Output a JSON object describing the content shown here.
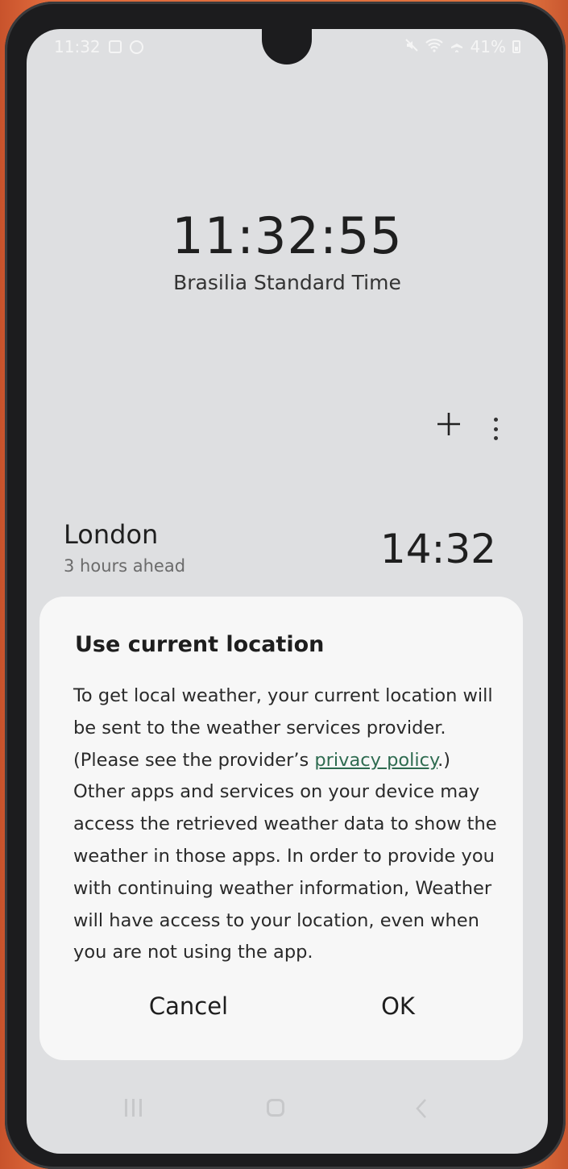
{
  "status_bar": {
    "time": "11:32",
    "battery": "41%"
  },
  "clock": {
    "time": "11:32:55",
    "zone": "Brasilia Standard Time"
  },
  "toolbar": {
    "add_icon": "plus-icon",
    "more_icon": "more-vertical-icon"
  },
  "world_clock": [
    {
      "city": "London",
      "difference": "3 hours ahead",
      "time": "14:32"
    }
  ],
  "dialog": {
    "title": "Use current location",
    "body_part1": "To get local weather, your current location will be sent to the weather services provider. (Please see the provider’s ",
    "link": "privacy policy",
    "body_part2": ".) Other apps and services on your device may access the retrieved weather data to show the weather in those apps. In order to provide you with continuing weather information, Weather will have access to your location, even when you are not using the app.",
    "cancel_label": "Cancel",
    "ok_label": "OK"
  },
  "colors": {
    "link": "#2e6b50",
    "screen_bg": "#dedfe1",
    "dialog_bg": "#f7f7f7"
  }
}
